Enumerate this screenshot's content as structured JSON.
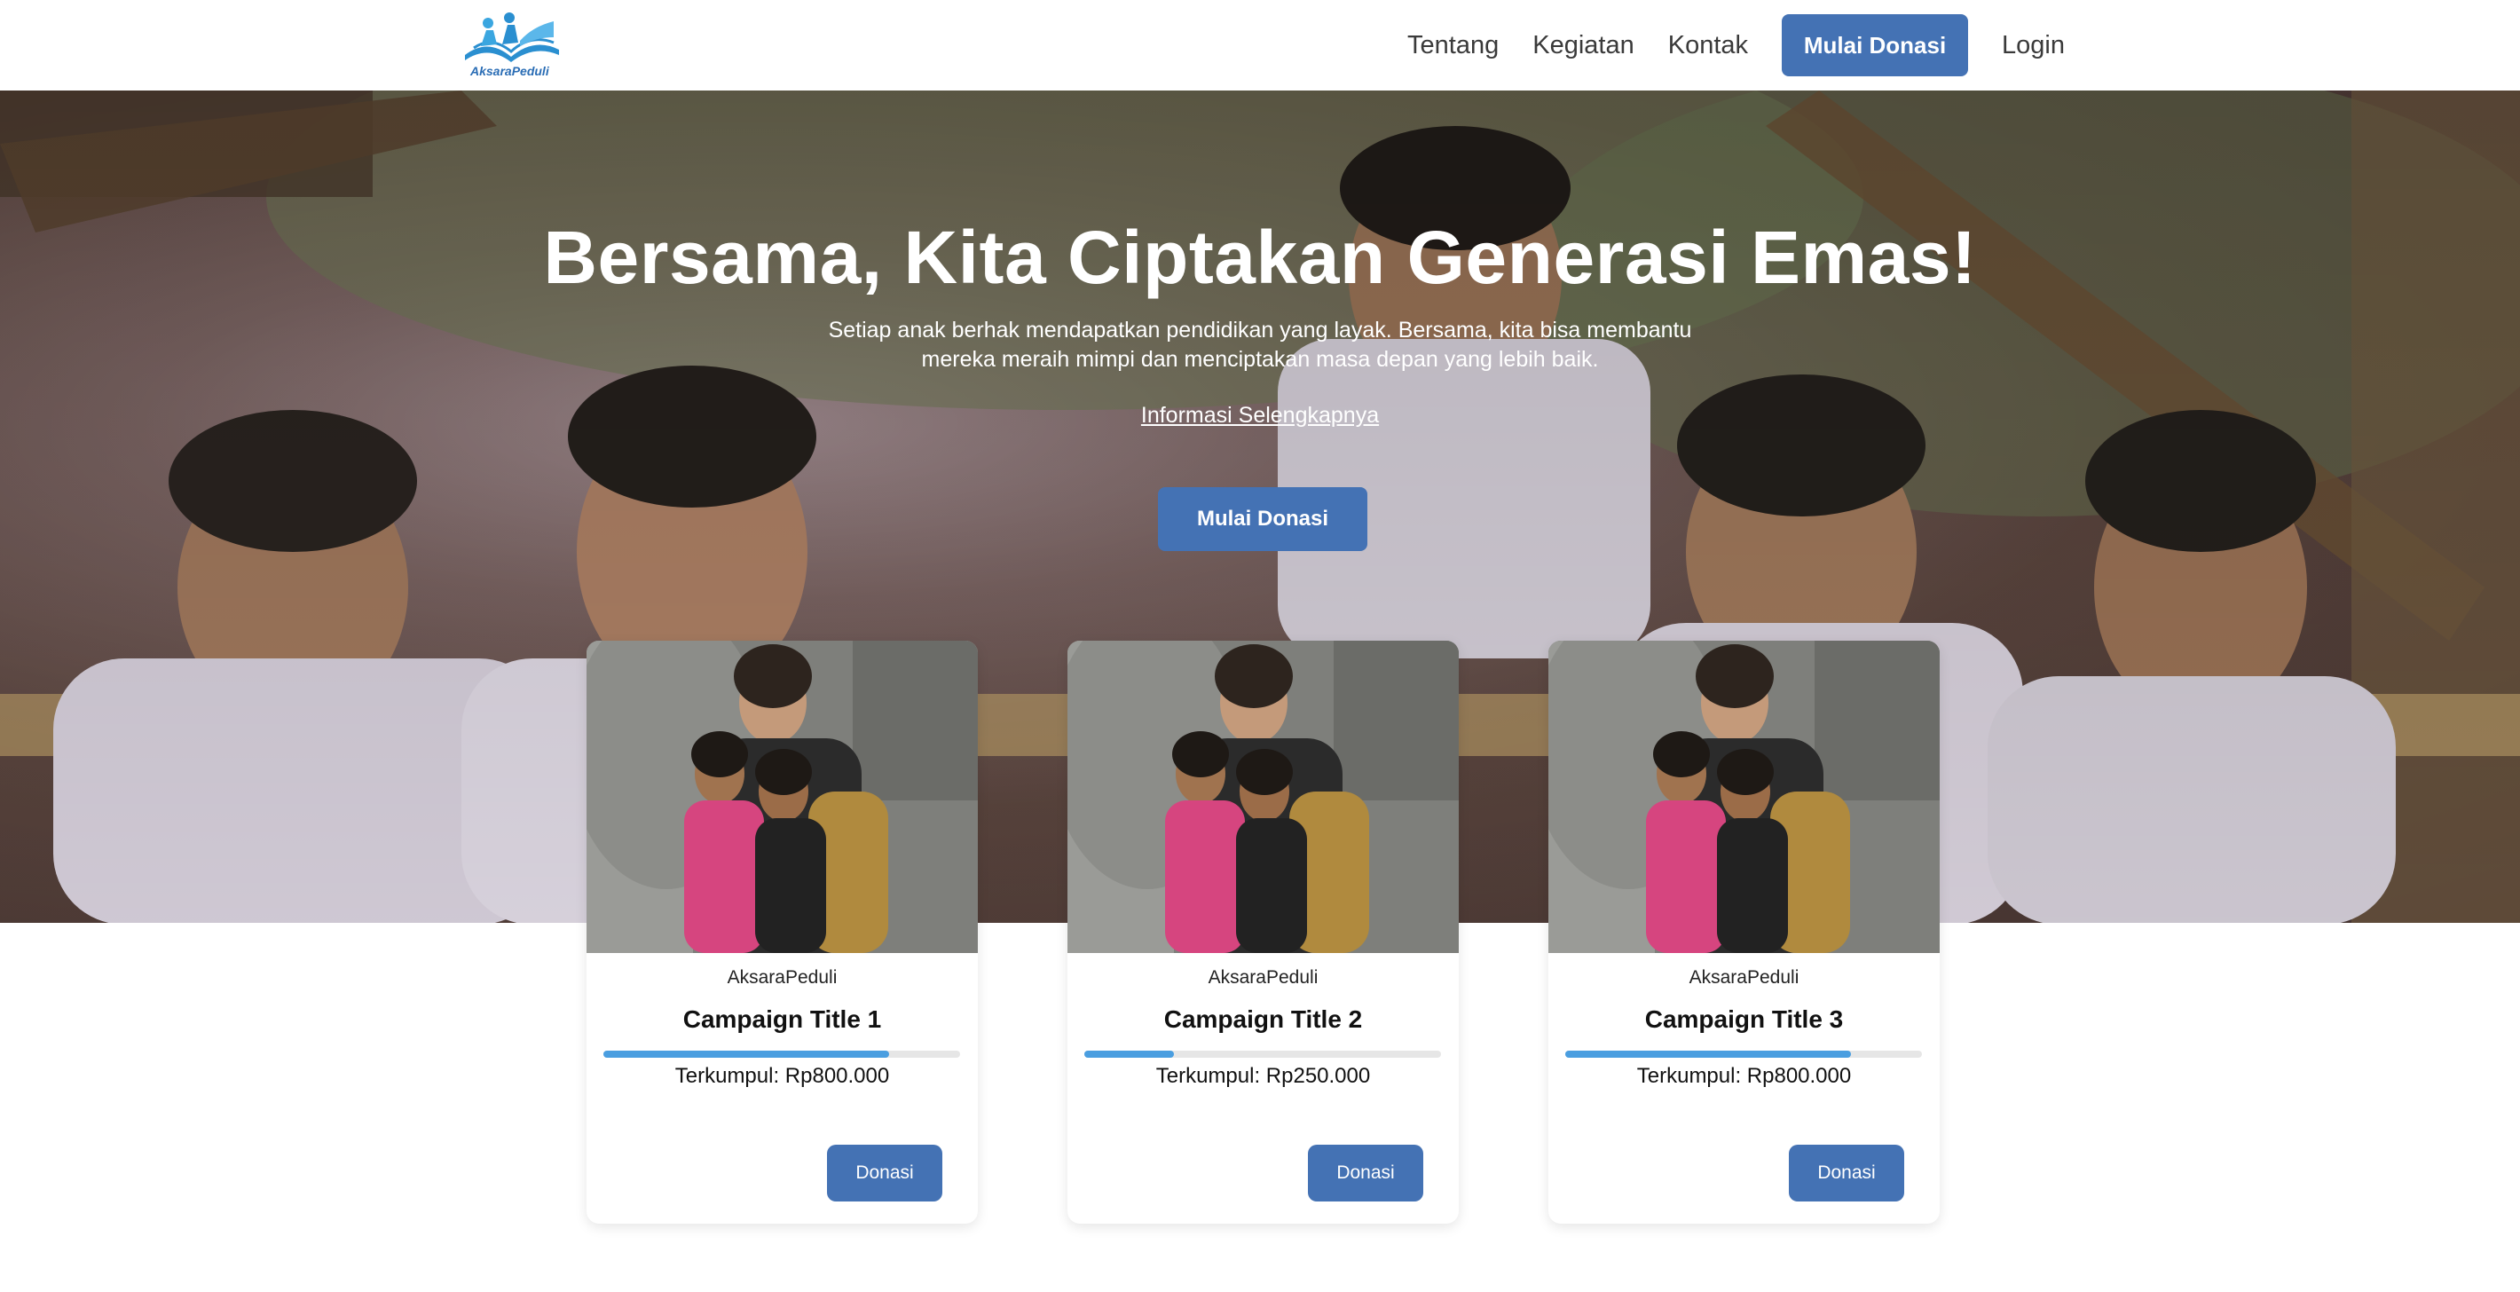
{
  "brand": {
    "name": "AksaraPeduli",
    "logo_icon": "book-people-icon",
    "accent": "#4472b4"
  },
  "nav": {
    "items": [
      {
        "label": "Tentang"
      },
      {
        "label": "Kegiatan"
      },
      {
        "label": "Kontak"
      }
    ],
    "cta_label": "Mulai Donasi",
    "login_label": "Login"
  },
  "hero": {
    "title": "Bersama, Kita Ciptakan Generasi Emas!",
    "subtitle_line1": "Setiap anak berhak mendapatkan pendidikan yang layak. Bersama, kita bisa membantu",
    "subtitle_line2": "mereka meraih mimpi dan menciptakan masa depan yang lebih baik.",
    "link_label": "Informasi Selengkapnya",
    "button_label": "Mulai Donasi"
  },
  "campaigns": [
    {
      "org": "AksaraPeduli",
      "title": "Campaign Title 1",
      "progress": 0.8,
      "raised": "Terkumpul: Rp800.000",
      "button": "Donasi"
    },
    {
      "org": "AksaraPeduli",
      "title": "Campaign Title 2",
      "progress": 0.25,
      "raised": "Terkumpul: Rp250.000",
      "button": "Donasi"
    },
    {
      "org": "AksaraPeduli",
      "title": "Campaign Title 3",
      "progress": 0.8,
      "raised": "Terkumpul: Rp800.000",
      "button": "Donasi"
    }
  ],
  "colors": {
    "primary": "#4472b4",
    "progress": "#4a9ee0",
    "progress_track": "#e6e6e6"
  }
}
